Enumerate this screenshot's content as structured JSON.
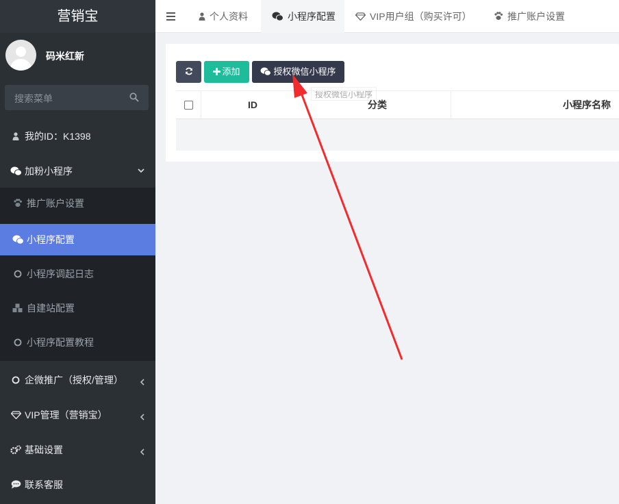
{
  "app": {
    "logo": "营销宝"
  },
  "user": {
    "name": "码米红新"
  },
  "search": {
    "placeholder": "搜索菜单"
  },
  "sidebar": {
    "my_id": "我的ID：K1398",
    "group_label": "加粉小程序",
    "sub_items": [
      {
        "label": "推广账户设置",
        "icon": "paw-icon"
      },
      {
        "label": "小程序配置",
        "icon": "wechat-icon",
        "active": true
      },
      {
        "label": "小程序调起日志",
        "icon": "circle-icon"
      },
      {
        "label": "自建站配置",
        "icon": "cubes-icon"
      },
      {
        "label": "小程序配置教程",
        "icon": "circle-icon"
      }
    ],
    "items": [
      {
        "label": "企微推广（授权/管理）",
        "icon": "circle-icon"
      },
      {
        "label": "VIP管理（营销宝）",
        "icon": "diamond-icon"
      },
      {
        "label": "基础设置",
        "icon": "cogs-icon"
      },
      {
        "label": "联系客服",
        "icon": "comment-icon"
      }
    ]
  },
  "topbar": {
    "tabs": [
      {
        "label": "个人资料",
        "icon": "user-icon"
      },
      {
        "label": "小程序配置",
        "icon": "wechat-icon",
        "active": true
      },
      {
        "label": "VIP用户组（购买许可）",
        "icon": "diamond-icon"
      },
      {
        "label": "推广账户设置",
        "icon": "paw-icon"
      }
    ]
  },
  "toolbar": {
    "add_label": "添加",
    "auth_label": "授权微信小程序",
    "tooltip": "授权微信小程序"
  },
  "table": {
    "columns": [
      "ID",
      "分类",
      "小程序名称"
    ]
  },
  "colors": {
    "sidebar_bg": "#2b3035",
    "active_item": "#5b7ce0",
    "add_button": "#1fbc9c",
    "auth_button": "#34394b",
    "annotation_arrow": "#f22c2c"
  }
}
